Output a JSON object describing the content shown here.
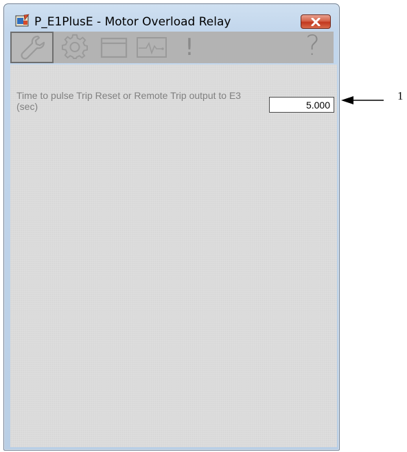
{
  "window": {
    "title": "P_E1PlusE - Motor Overload Relay",
    "close_symbol": "✕"
  },
  "toolbar": {
    "tabs": [
      {
        "name": "maintenance",
        "icon": "wrench-icon",
        "selected": true
      },
      {
        "name": "engineering",
        "icon": "gear-icon",
        "selected": false
      },
      {
        "name": "faceplate",
        "icon": "window-icon",
        "selected": false
      },
      {
        "name": "trends",
        "icon": "trend-icon",
        "selected": false
      },
      {
        "name": "alarms",
        "icon": "exclamation-icon",
        "glyph": "!",
        "selected": false
      }
    ],
    "help_glyph": "?"
  },
  "parameter": {
    "label": "Time to pulse Trip Reset or Remote Trip output to E3 (sec)",
    "value": "5.000"
  },
  "callout": {
    "number": "1"
  }
}
